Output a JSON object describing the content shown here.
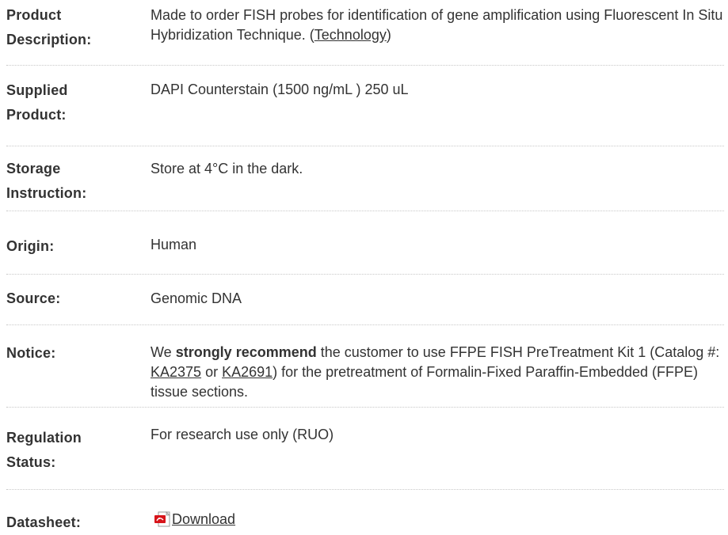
{
  "rows": [
    {
      "label_line1": "Product",
      "label_line2": "Description:",
      "value_text": "Made to order FISH probes for identification of gene amplification using Fluorescent In Situ Hybridization Technique. (",
      "value_link": "Technology",
      "value_tail": ")"
    },
    {
      "label_line1": "Supplied",
      "label_line2": "Product:",
      "value": "DAPI Counterstain (1500 ng/mL ) 250 uL"
    },
    {
      "label_line1": "Storage",
      "label_line2": "Instruction:",
      "value": "Store at 4°C in the dark."
    },
    {
      "label": "Origin:",
      "value": "Human"
    },
    {
      "label": "Source:",
      "value": "Genomic DNA"
    },
    {
      "label": "Notice:",
      "value_pre": "We ",
      "value_strong": "strongly recommend",
      "value_mid": " the customer to use FFPE FISH PreTreatment Kit 1 (Catalog #: ",
      "link1": "KA2375",
      "value_or": " or ",
      "link2": "KA2691",
      "value_post": ") for the pretreatment of Formalin-Fixed Paraffin-Embedded (FFPE) tissue sections."
    },
    {
      "label_line1": "Regulation",
      "label_line2": "Status:",
      "value": "For research use only (RUO)"
    },
    {
      "label": "Datasheet:",
      "link": "Download",
      "icon": "pdf-icon"
    }
  ],
  "colors": {
    "text": "#333333",
    "divider": "#c8c8c8",
    "pdf_red": "#d7141a"
  }
}
